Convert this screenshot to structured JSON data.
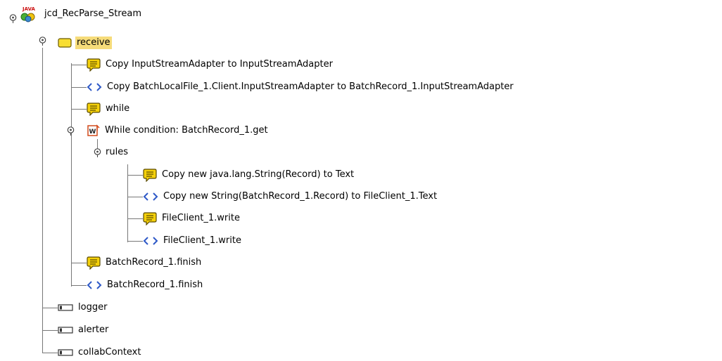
{
  "tree": {
    "nodes": [
      {
        "label": "jcd_RecParse_Stream",
        "icon": "java-collaboration-icon",
        "icon_text": "JAVA",
        "expanded": true
      },
      {
        "label": "receive",
        "icon": "method-folder-icon",
        "expanded": true,
        "selected": true
      },
      {
        "label": "Copy InputStreamAdapter to InputStreamAdapter",
        "icon": "comment-icon"
      },
      {
        "label": "Copy BatchLocalFile_1.Client.InputStreamAdapter to BatchRecord_1.InputStreamAdapter",
        "icon": "map-icon"
      },
      {
        "label": "while",
        "icon": "comment-icon"
      },
      {
        "label": "While condition: BatchRecord_1.get",
        "icon": "while-loop-icon",
        "icon_text": "W",
        "expanded": true
      },
      {
        "label": "rules",
        "icon": "none",
        "expanded": true
      },
      {
        "label": "Copy new java.lang.String(Record) to Text",
        "icon": "comment-icon"
      },
      {
        "label": "Copy new String(BatchRecord_1.Record) to FileClient_1.Text",
        "icon": "map-icon"
      },
      {
        "label": "FileClient_1.write",
        "icon": "comment-icon"
      },
      {
        "label": "FileClient_1.write",
        "icon": "map-icon"
      },
      {
        "label": "BatchRecord_1.finish",
        "icon": "comment-icon"
      },
      {
        "label": "BatchRecord_1.finish",
        "icon": "map-icon"
      },
      {
        "label": "logger",
        "icon": "bean-field-icon"
      },
      {
        "label": "alerter",
        "icon": "bean-field-icon"
      },
      {
        "label": "collabContext",
        "icon": "bean-field-icon"
      }
    ]
  },
  "colors": {
    "selection": "#f6dc7a",
    "comment_icon": "#f5d10a",
    "map_icon": "#2e59c7",
    "while_icon": "#d24a1b",
    "folder_icon": "#f8de32",
    "tree_line": "#777777"
  }
}
